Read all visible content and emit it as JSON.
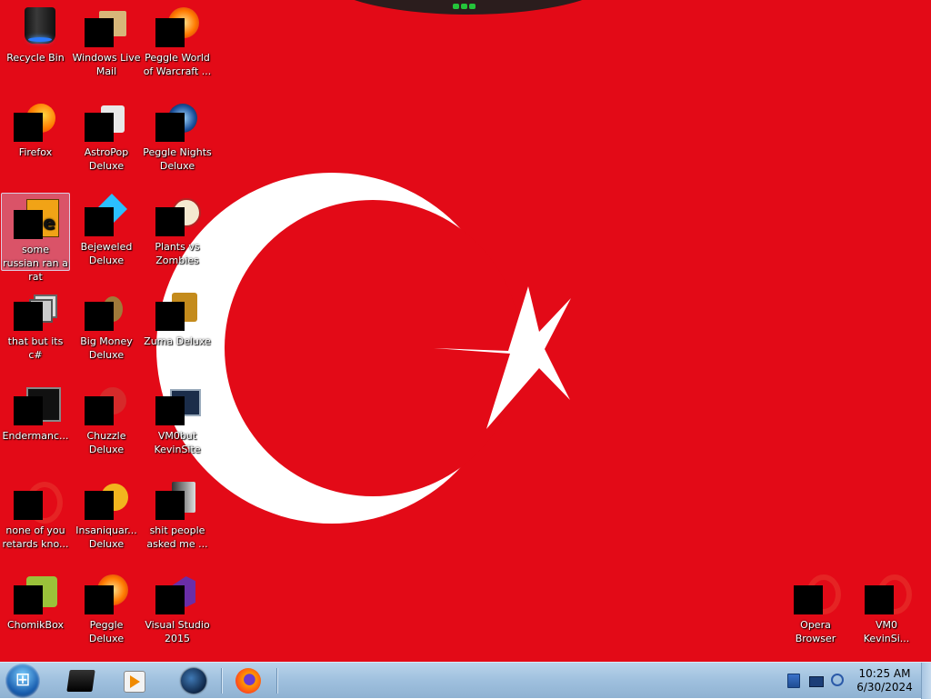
{
  "wallpaper": {
    "flag": "turkey",
    "colors": {
      "red": "#e30a17",
      "white": "#ffffff"
    }
  },
  "desktop_icons": [
    {
      "name": "recycle-bin",
      "label": "Recycle Bin",
      "icon": "recycle-bin-icon"
    },
    {
      "name": "windows-live-mail",
      "label": "Windows Live Mail",
      "icon": "mail-icon"
    },
    {
      "name": "peggle-world-of-warcraft",
      "label": "Peggle World of Warcraft ...",
      "icon": "peggle-icon"
    },
    {
      "name": "firefox",
      "label": "Firefox",
      "icon": "firefox-icon"
    },
    {
      "name": "astropop-deluxe",
      "label": "AstroPop Deluxe",
      "icon": "astropop-icon"
    },
    {
      "name": "peggle-nights-deluxe",
      "label": "Peggle Nights Deluxe",
      "icon": "peggle-nights-icon"
    },
    {
      "name": "some-russian-ran-a-rat",
      "label": "some russian ran a rat",
      "icon": "shortcut-icon"
    },
    {
      "name": "bejeweled-deluxe",
      "label": "Bejeweled Deluxe",
      "icon": "gem-icon"
    },
    {
      "name": "plants-vs-zombies",
      "label": "Plants vs Zombies",
      "icon": "plant-icon"
    },
    {
      "name": "that-but-its-csharp",
      "label": "that but its c#",
      "icon": "windows-stack-icon"
    },
    {
      "name": "big-money-deluxe",
      "label": "Big Money Deluxe",
      "icon": "money-bag-icon"
    },
    {
      "name": "zuma-deluxe",
      "label": "Zuma Deluxe",
      "icon": "zuma-icon"
    },
    {
      "name": "endermanch",
      "label": "Endermanc...",
      "icon": "terminal-icon"
    },
    {
      "name": "chuzzle-deluxe",
      "label": "Chuzzle Deluxe",
      "icon": "chuzzle-icon"
    },
    {
      "name": "vmobut-kevinsite",
      "label": "VM0but KevinSite",
      "icon": "monitor-icon"
    },
    {
      "name": "none-of-you-retards",
      "label": "none of you retards kno...",
      "icon": "opera-icon"
    },
    {
      "name": "insaniquarium-deluxe",
      "label": "Insaniquar... Deluxe",
      "icon": "fish-icon"
    },
    {
      "name": "shit-people-asked-me",
      "label": "shit people asked me ...",
      "icon": "folder-icon"
    },
    {
      "name": "chomikbox",
      "label": "ChomikBox",
      "icon": "chomikbox-icon"
    },
    {
      "name": "peggle-deluxe",
      "label": "Peggle Deluxe",
      "icon": "peggle-icon"
    },
    {
      "name": "visual-studio-2015",
      "label": "Visual Studio 2015",
      "icon": "visual-studio-icon"
    },
    {
      "name": "opera-browser",
      "label": "Opera Browser",
      "icon": "opera-icon"
    },
    {
      "name": "vm0-kevinsite",
      "label": "VM0 KevinSi...",
      "icon": "opera-icon"
    }
  ],
  "taskbar": {
    "start_button": "start-orb",
    "pinned": [
      {
        "name": "taskbar-black-app",
        "icon": "black-box-icon"
      },
      {
        "name": "taskbar-media-player",
        "icon": "media-player-icon"
      },
      {
        "name": "taskbar-globe",
        "icon": "globe-icon"
      },
      {
        "name": "taskbar-firefox",
        "icon": "firefox-icon"
      }
    ],
    "tray": [
      {
        "name": "tray-flag",
        "icon": "flag-icon"
      },
      {
        "name": "tray-network",
        "icon": "network-icon"
      },
      {
        "name": "tray-volume",
        "icon": "volume-icon"
      }
    ],
    "clock": {
      "time": "10:25 AM",
      "date": "6/30/2024"
    }
  }
}
